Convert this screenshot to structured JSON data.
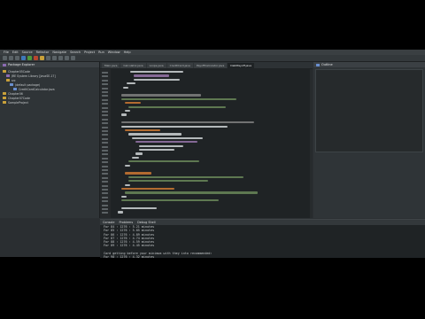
{
  "menu": [
    "File",
    "Edit",
    "Source",
    "Refactor",
    "Navigate",
    "Search",
    "Project",
    "Run",
    "Window",
    "Help"
  ],
  "package_explorer": {
    "title": "Package Explorer",
    "items": [
      {
        "label": "Chapter05Code",
        "icon": "project-icon"
      },
      {
        "label": "JRE System Library [JavaSE-17]",
        "icon": "library-icon"
      },
      {
        "label": "src",
        "icon": "folder-icon"
      },
      {
        "label": "(default package)",
        "icon": "package-icon"
      },
      {
        "label": "CreditCardCalculator.java",
        "icon": "java-file-icon"
      },
      {
        "label": "Chapter06",
        "icon": "project-icon"
      },
      {
        "label": "Chapter07Code",
        "icon": "project-icon"
      },
      {
        "label": "SampleProject",
        "icon": "project-icon"
      }
    ]
  },
  "editor_tabs": [
    "Main.java",
    "Calculator.java",
    "Loops.java",
    "CreditCard.java",
    "PayoffCalculator.java",
    "Interest.java",
    "DebtPayoff.java"
  ],
  "outline_title": "Outline",
  "console": {
    "tabs": [
      "Console",
      "Problems",
      "Debug Shell"
    ],
    "lines": [
      "For 84 : 1276 : 5.21 minutes",
      "For 85 : 1276 : 5.05 minutes",
      "For 86 : 1276 : 4.89 minutes",
      "For 87 : 1276 : 4.74 minutes",
      "For 88 : 1276 : 4.59 minutes",
      "For 89 : 1276 : 4.45 minutes",
      "",
      "Card getting before your minimum with they into recommended:",
      "For 90 : 1276 : 4.32 minutes",
      "For 90 : 1276 : 4.32 minutes"
    ]
  },
  "colors": {
    "accent": "#3f78b8",
    "keyword": "#cc7832",
    "string": "#6a8759",
    "comment": "#808080",
    "field": "#9876aa"
  }
}
